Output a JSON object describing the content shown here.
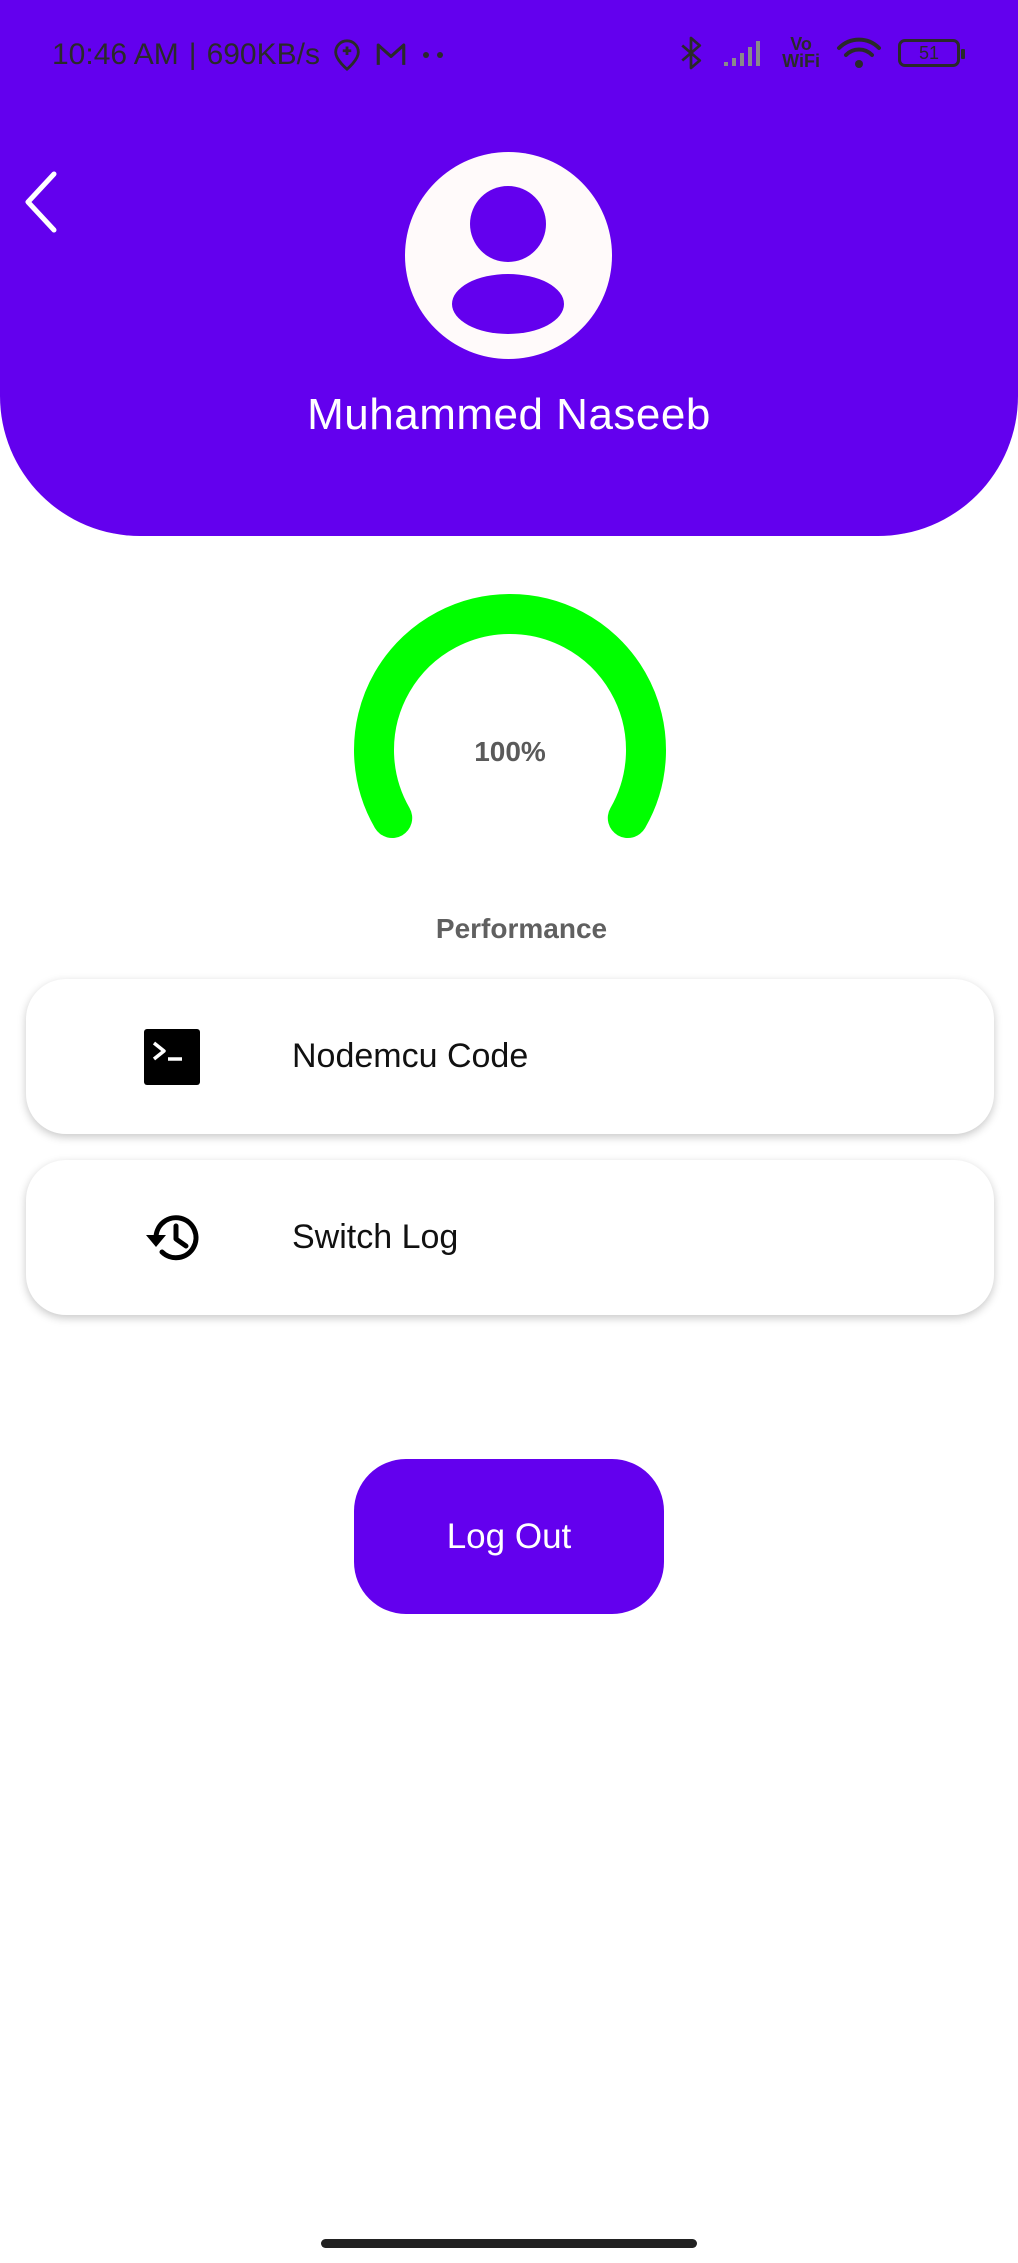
{
  "status_bar": {
    "time": "10:46 AM",
    "separator": "|",
    "network_speed": "690KB/s",
    "vowifi_top": "Vo",
    "vowifi_bottom": "WiFi",
    "battery_level": "51"
  },
  "header": {
    "user_name": "Muhammed Naseeb",
    "color": "#6300ee"
  },
  "performance": {
    "value_text": "100%",
    "value": 100,
    "label": "Performance",
    "gauge_color": "#00ff00"
  },
  "menu": [
    {
      "label": "Nodemcu Code",
      "icon": "terminal-icon"
    },
    {
      "label": "Switch Log",
      "icon": "history-icon"
    }
  ],
  "logout": {
    "label": "Log Out"
  }
}
